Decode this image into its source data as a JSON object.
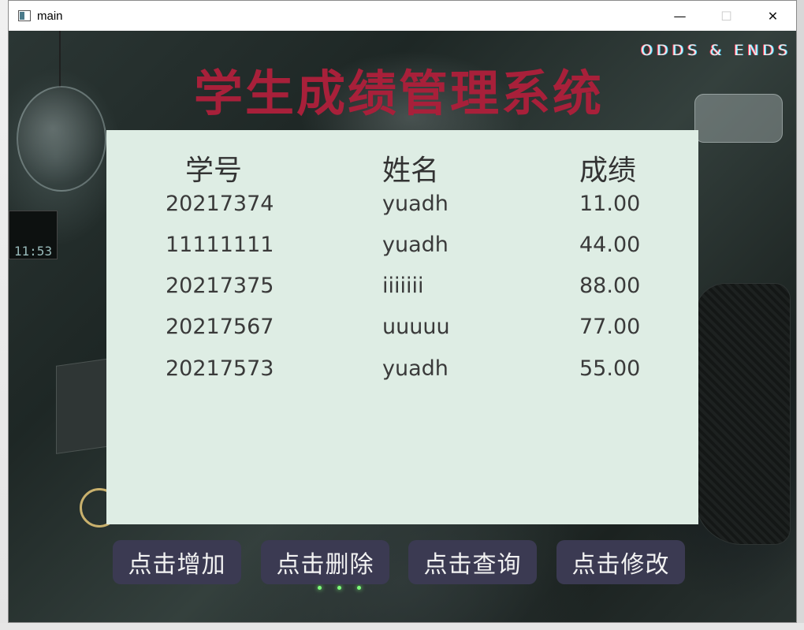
{
  "window": {
    "title": "main",
    "minimize_glyph": "—",
    "maximize_glyph": "☐",
    "close_glyph": "✕"
  },
  "brand": "ODDS & ENDS",
  "clock_text": "11:53",
  "page_title": "学生成绩管理系统",
  "table": {
    "headers": [
      "学号",
      "姓名",
      "成绩"
    ],
    "rows": [
      [
        "20217374",
        "yuadh",
        "11.00"
      ],
      [
        "11111111",
        "yuadh",
        "44.00"
      ],
      [
        "20217375",
        "iiiiiii",
        "88.00"
      ],
      [
        "20217567",
        "uuuuu",
        "77.00"
      ],
      [
        "20217573",
        "yuadh",
        "55.00"
      ]
    ]
  },
  "buttons": {
    "add": "点击增加",
    "delete": "点击删除",
    "query": "点击查询",
    "edit": "点击修改"
  },
  "colors": {
    "title": "#a8203a",
    "panel": "#deede4",
    "button": "#3b3a52"
  }
}
